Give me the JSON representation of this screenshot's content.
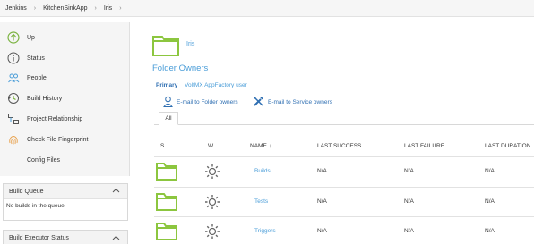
{
  "breadcrumb": [
    "Jenkins",
    "KitchenSinkApp",
    "Iris"
  ],
  "breadcrumb_separator": "›",
  "sidebar": {
    "items": [
      {
        "label": "Up",
        "icon": "up-arrow-icon"
      },
      {
        "label": "Status",
        "icon": "info-icon"
      },
      {
        "label": "People",
        "icon": "people-icon"
      },
      {
        "label": "Build History",
        "icon": "build-history-icon"
      },
      {
        "label": "Project Relationship",
        "icon": "relationship-icon"
      },
      {
        "label": "Check File Fingerprint",
        "icon": "fingerprint-icon"
      },
      {
        "label": "Config Files",
        "icon": ""
      }
    ]
  },
  "build_queue": {
    "title": "Build Queue",
    "body": "No builds in the queue."
  },
  "build_executor": {
    "title": "Build Executor Status"
  },
  "main": {
    "folder_name": "Iris",
    "section_title": "Folder Owners",
    "primary_label": "Primary",
    "primary_value": "VoltMX AppFactory user",
    "email_folder_owners": "E-mail to Folder owners",
    "email_service_owners": "E-mail to Service owners",
    "tab_all": "All"
  },
  "table": {
    "headers": [
      "S",
      "W",
      "NAME ↓",
      "LAST SUCCESS",
      "LAST FAILURE",
      "LAST DURATION"
    ],
    "rows": [
      {
        "name": "Builds",
        "last_success": "N/A",
        "last_failure": "N/A",
        "last_duration": "N/A"
      },
      {
        "name": "Tests",
        "last_success": "N/A",
        "last_failure": "N/A",
        "last_duration": "N/A"
      },
      {
        "name": "Triggers",
        "last_success": "N/A",
        "last_failure": "N/A",
        "last_duration": "N/A"
      }
    ]
  },
  "colors": {
    "folder_green": "#8cc63f",
    "link_blue": "#4a9dd8",
    "icon_green": "#7cb342"
  }
}
